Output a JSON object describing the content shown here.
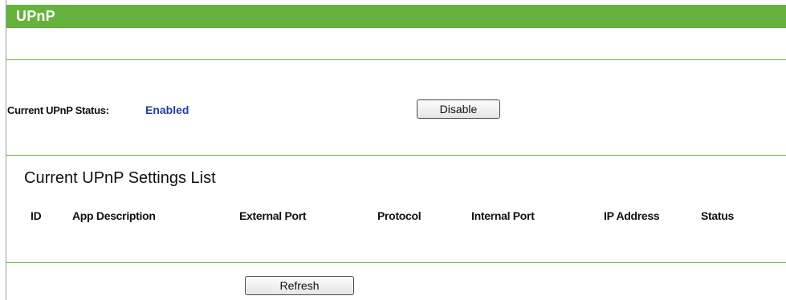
{
  "header": {
    "title": "UPnP"
  },
  "upnp_status": {
    "label": "Current UPnP Status:",
    "value": "Enabled",
    "value_color": "#1f3ea8",
    "toggle_button_label": "Disable"
  },
  "settings_list": {
    "title": "Current UPnP Settings List",
    "columns": [
      "ID",
      "App Description",
      "External Port",
      "Protocol",
      "Internal Port",
      "IP Address",
      "Status"
    ],
    "rows": []
  },
  "actions": {
    "refresh_label": "Refresh"
  },
  "colors": {
    "accent": "#65b33c"
  }
}
